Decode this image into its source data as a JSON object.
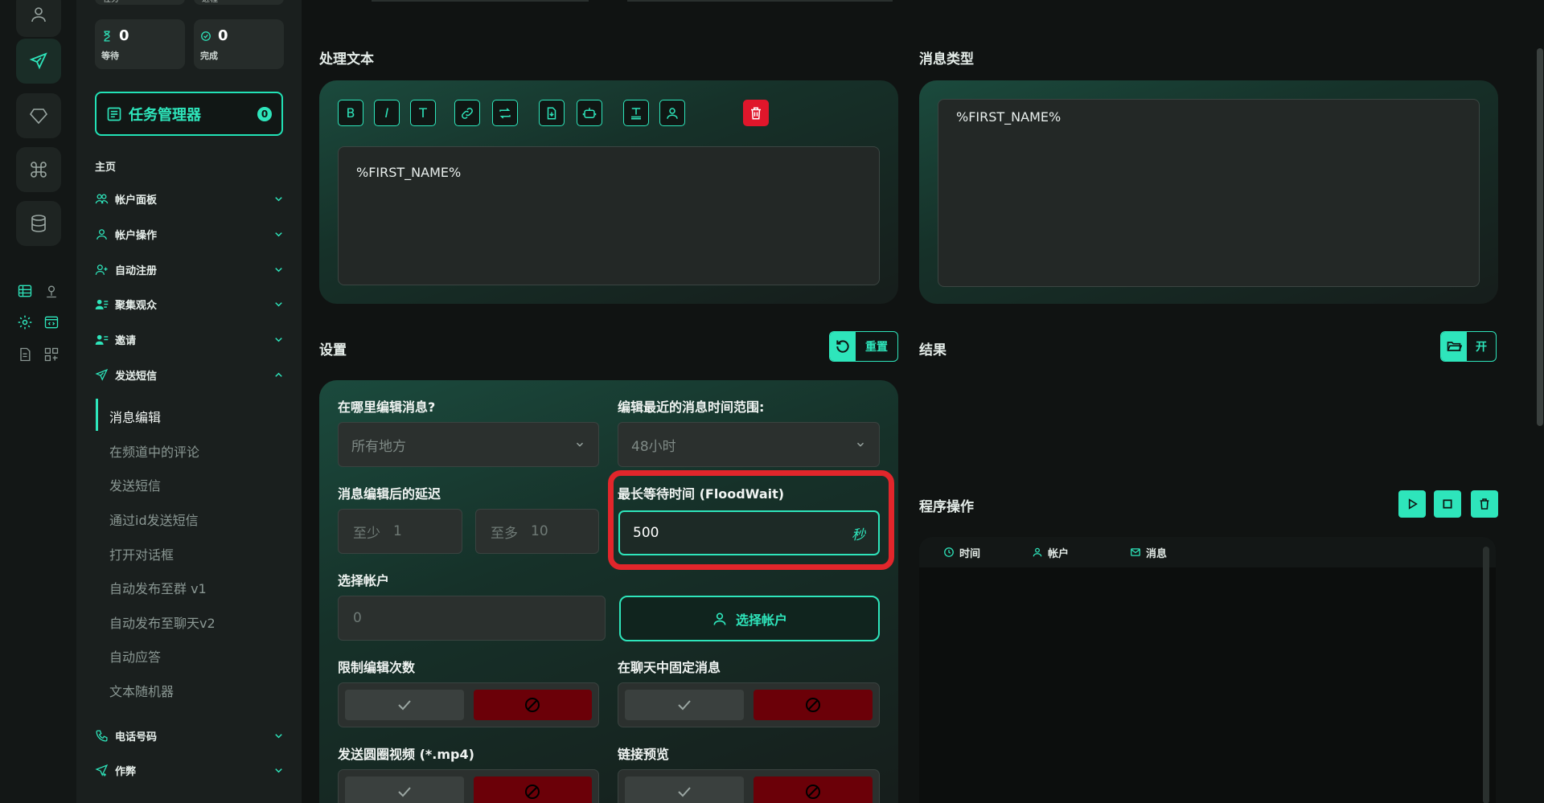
{
  "stats": {
    "prev_left": "任务",
    "prev_right": "进程",
    "waiting": {
      "value": "0",
      "label": "等待"
    },
    "done": {
      "value": "0",
      "label": "完成"
    }
  },
  "task_manager": {
    "label": "任务管理器",
    "count": "0"
  },
  "sidebar": {
    "home": "主页",
    "items": [
      {
        "label": "帐户面板"
      },
      {
        "label": "帐户操作"
      },
      {
        "label": "自动注册"
      },
      {
        "label": "聚集观众"
      },
      {
        "label": "邀请"
      },
      {
        "label": "发送短信"
      },
      {
        "label": "电话号码"
      },
      {
        "label": "作弊"
      }
    ],
    "sub_items": [
      "消息编辑",
      "在频道中的评论",
      "发送短信",
      "通过id发送短信",
      "打开对话框",
      "自动发布至群 v1",
      "自动发布至聊天v2",
      "自动应答",
      "文本随机器"
    ]
  },
  "editor": {
    "title": "处理文本",
    "toolbar": {
      "bold": "B",
      "italic": "I",
      "text": "T"
    },
    "content": "%FIRST_NAME%"
  },
  "message_type": {
    "title": "消息类型",
    "content": "%FIRST_NAME%"
  },
  "settings": {
    "title": "设置",
    "reset_label": "重置",
    "where_label": "在哪里编辑消息?",
    "where_value": "所有地方",
    "range_label": "编辑最近的消息时间范围:",
    "range_value": "48小时",
    "delay_label": "消息编辑后的延迟",
    "delay_min_prefix": "至少",
    "delay_min": "1",
    "delay_max_prefix": "至多",
    "delay_max": "10",
    "floodwait_label": "最长等待时间 (FloodWait)",
    "floodwait_value": "500",
    "floodwait_unit": "秒",
    "accounts_label": "选择帐户",
    "accounts_value": "0",
    "choose_accounts_button": "选择帐户",
    "limit_edits_label": "限制编辑次数",
    "pin_label": "在聊天中固定消息",
    "video_label": "发送圆圈视频 (*.mp4)",
    "link_preview_label": "链接预览"
  },
  "results": {
    "title": "结果",
    "open_label": "开"
  },
  "program_ops": {
    "title": "程序操作",
    "columns": [
      "时间",
      "帐户",
      "消息"
    ]
  },
  "colors": {
    "accent": "#2ee5bb",
    "danger": "#e0162b",
    "highlight": "#e1262b"
  }
}
